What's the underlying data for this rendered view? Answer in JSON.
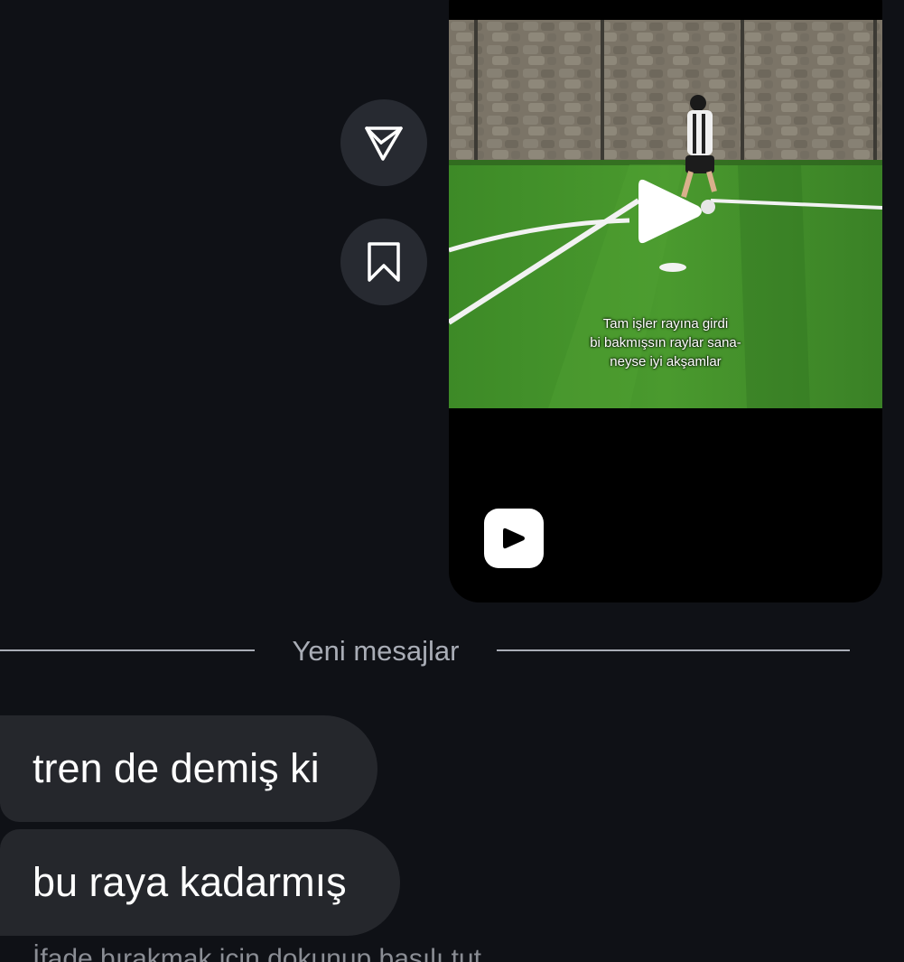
{
  "reel": {
    "caption_lines": [
      "Tam işler rayına girdi",
      "bi bakmışsın raylar sana-",
      "neyse iyi akşamlar"
    ],
    "play_icon": "play-icon",
    "badge_icon": "reels-icon"
  },
  "actions": {
    "share_icon": "send-icon",
    "save_icon": "bookmark-icon"
  },
  "divider": {
    "label": "Yeni mesajlar"
  },
  "messages": [
    {
      "text": "tren de demiş ki"
    },
    {
      "text": "bu raya kadarmış"
    }
  ],
  "hint": {
    "text": "İfade bırakmak için dokunup basılı tut"
  },
  "colors": {
    "background": "#0f1116",
    "bubble": "#25272c",
    "action_button": "#272a31",
    "divider": "#a9adb6",
    "turf": "#3f8a28"
  }
}
